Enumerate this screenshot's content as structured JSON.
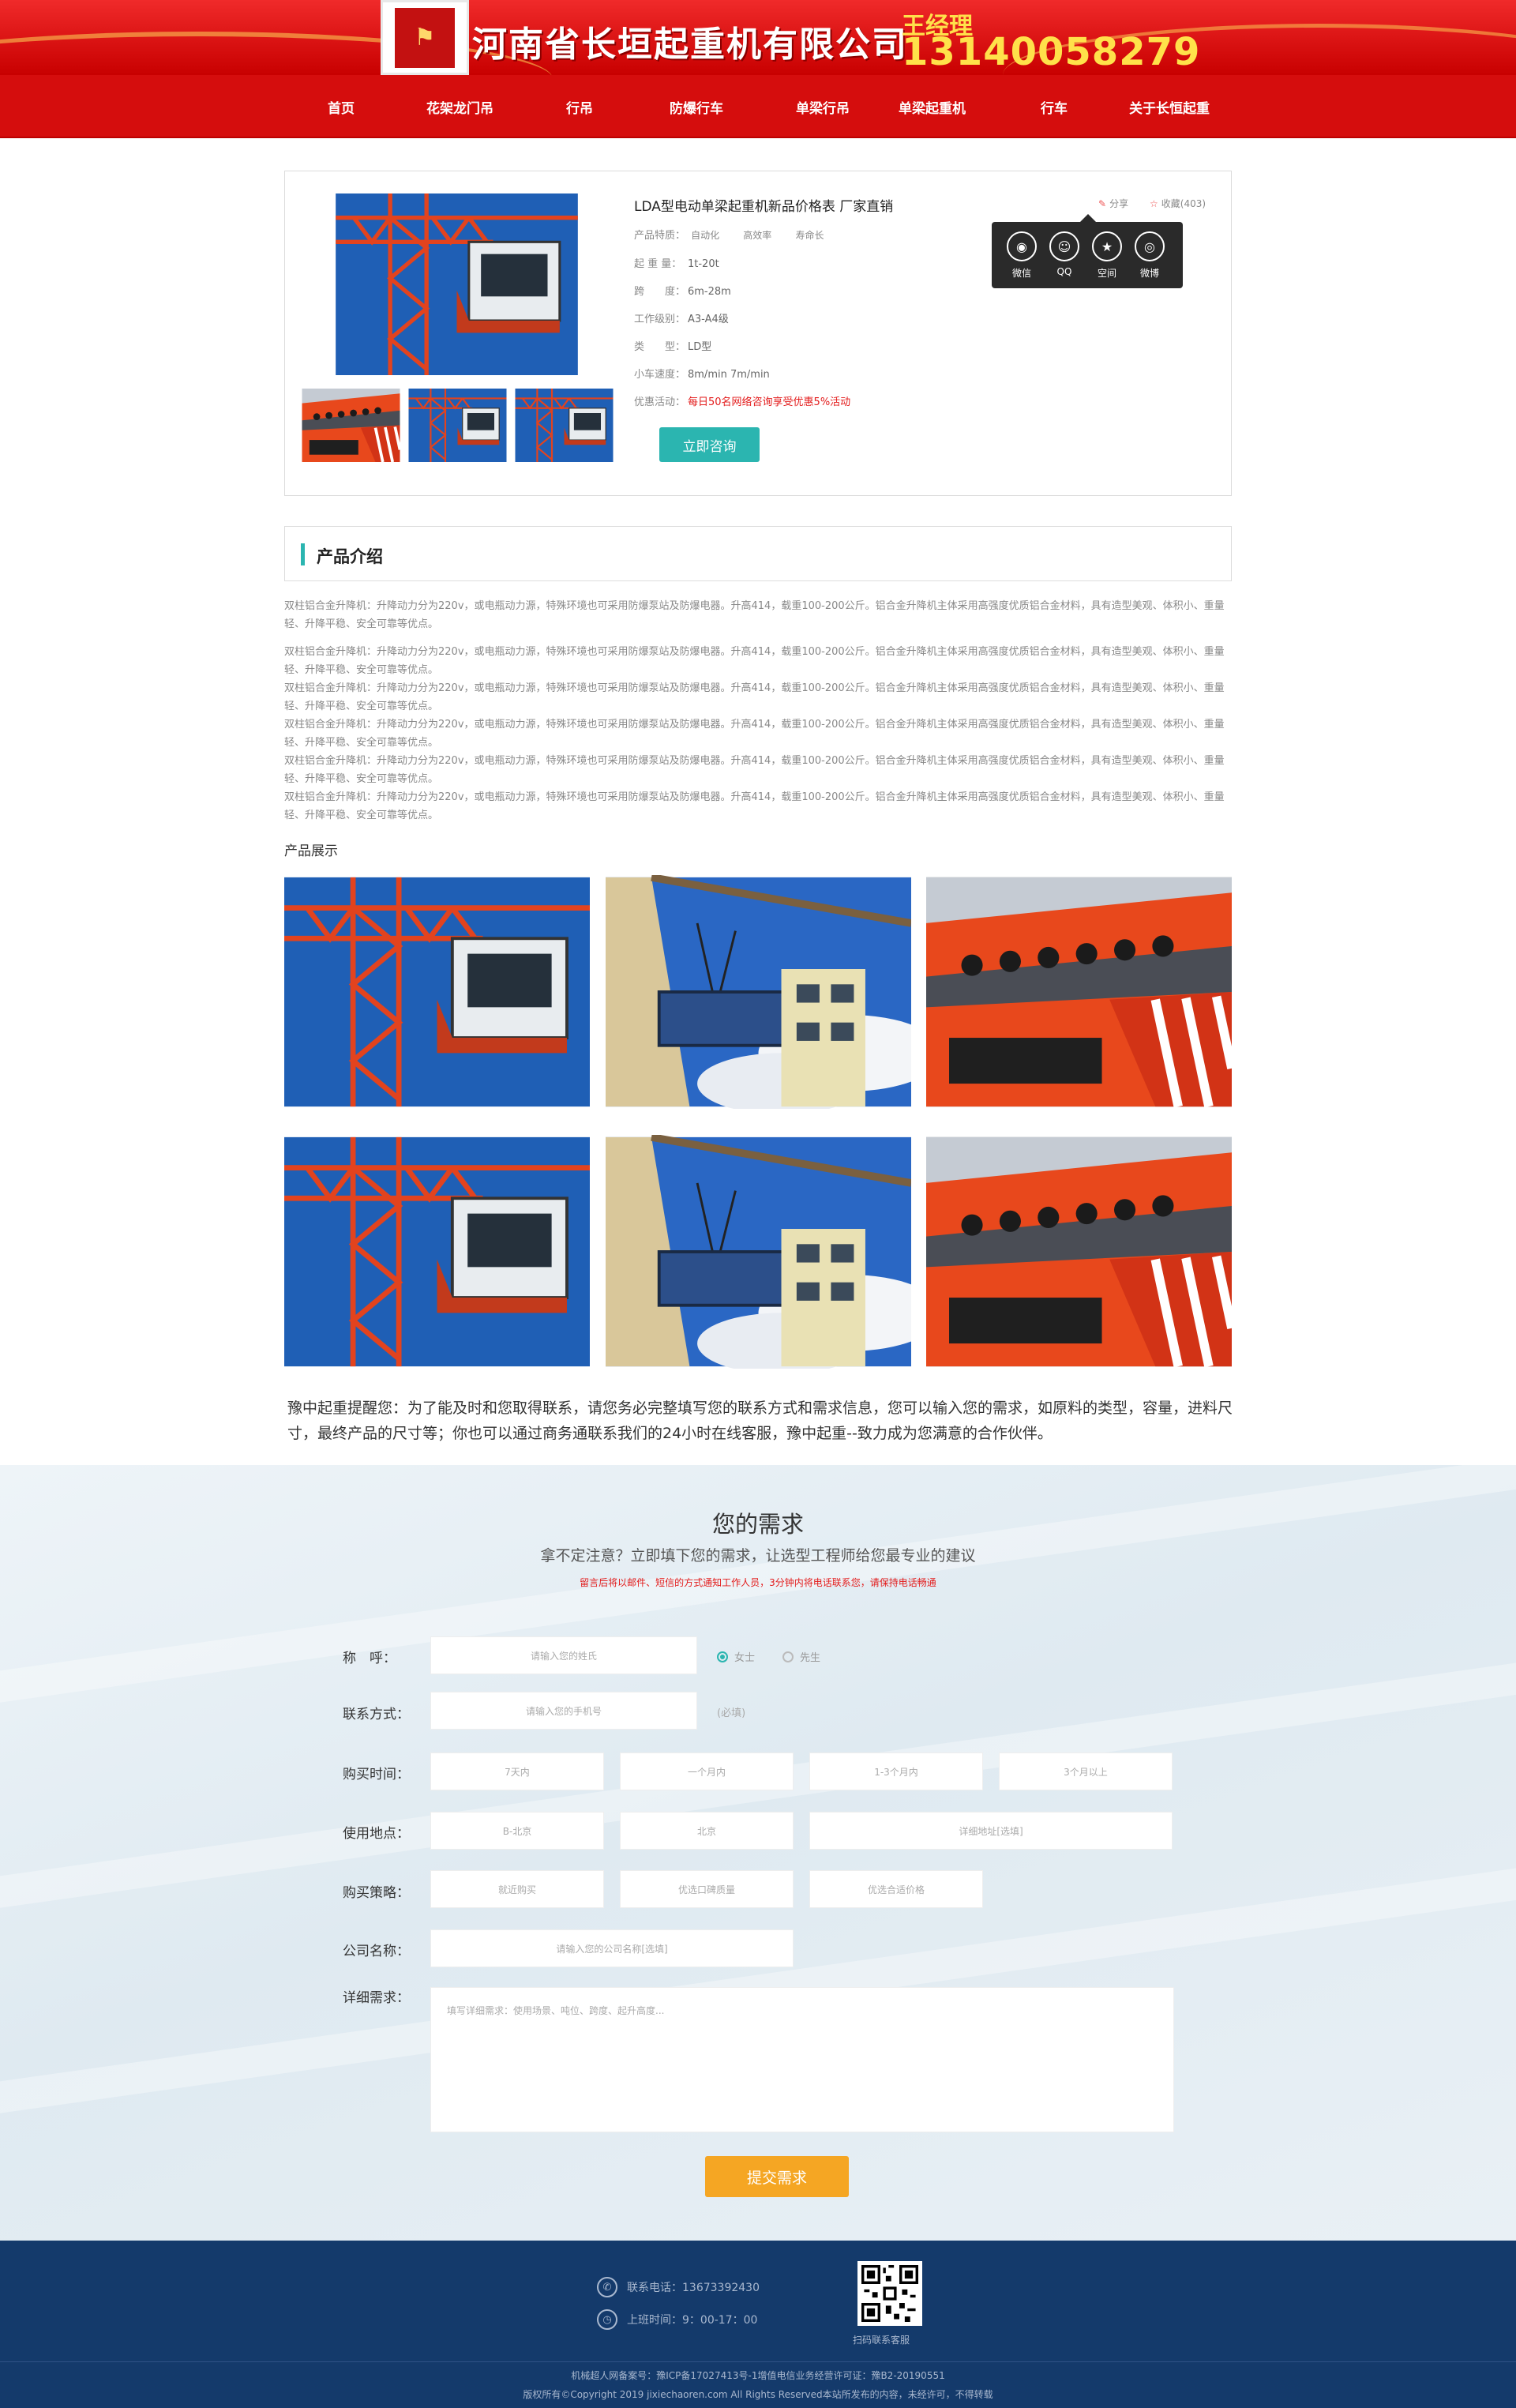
{
  "header": {
    "company_name": "河南省长垣起重机有限公司",
    "manager": "王经理",
    "phone": "13140058279"
  },
  "nav": [
    {
      "label": "首页"
    },
    {
      "label": "花架龙门吊"
    },
    {
      "label": "行吊"
    },
    {
      "label": "防爆行车"
    },
    {
      "label": "单梁行吊"
    },
    {
      "label": "单梁起重机"
    },
    {
      "label": "行车"
    },
    {
      "label": "关于长恒起重"
    }
  ],
  "product": {
    "title": "LDA型电动单梁起重机新品价格表 厂家直销",
    "features_label": "产品特质：",
    "features": [
      "自动化",
      "高效率",
      "寿命长"
    ],
    "specs": [
      {
        "k": "起 重 量：",
        "v": "1t-20t"
      },
      {
        "k": "跨　　度：",
        "v": "6m-28m"
      },
      {
        "k": "工作级别：",
        "v": "A3-A4级"
      },
      {
        "k": "类　　型：",
        "v": "LD型"
      },
      {
        "k": "小车速度：",
        "v": "8m/min 7m/min"
      }
    ],
    "promo_label": "优惠活动：",
    "promo_text": "每日50名网络咨询享受优惠5%活动",
    "consult_button": "立即咨询",
    "share_label": "分享",
    "collect_label": "收藏(403)",
    "share_options": [
      {
        "label": "微信",
        "icon": "wechat-icon"
      },
      {
        "label": "QQ",
        "icon": "qq-icon"
      },
      {
        "label": "空间",
        "icon": "qzone-icon"
      },
      {
        "label": "微博",
        "icon": "weibo-icon"
      }
    ]
  },
  "intro": {
    "heading": "产品介绍",
    "paragraphs": [
      "双柱铝合金升降机：升降动力分为220v，或电瓶动力源，特殊环境也可采用防爆泵站及防爆电器。升高414，载重100-200公斤。铝合金升降机主体采用高强度优质铝合金材料，具有造型美观、体积小、重量轻、升降平稳、安全可靠等优点。",
      "双柱铝合金升降机：升降动力分为220v，或电瓶动力源，特殊环境也可采用防爆泵站及防爆电器。升高414，载重100-200公斤。铝合金升降机主体采用高强度优质铝合金材料，具有造型美观、体积小、重量轻、升降平稳、安全可靠等优点。",
      "双柱铝合金升降机：升降动力分为220v，或电瓶动力源，特殊环境也可采用防爆泵站及防爆电器。升高414，载重100-200公斤。铝合金升降机主体采用高强度优质铝合金材料，具有造型美观、体积小、重量轻、升降平稳、安全可靠等优点。",
      "双柱铝合金升降机：升降动力分为220v，或电瓶动力源，特殊环境也可采用防爆泵站及防爆电器。升高414，载重100-200公斤。铝合金升降机主体采用高强度优质铝合金材料，具有造型美观、体积小、重量轻、升降平稳、安全可靠等优点。",
      "双柱铝合金升降机：升降动力分为220v，或电瓶动力源，特殊环境也可采用防爆泵站及防爆电器。升高414，载重100-200公斤。铝合金升降机主体采用高强度优质铝合金材料，具有造型美观、体积小、重量轻、升降平稳、安全可靠等优点。",
      "双柱铝合金升降机：升降动力分为220v，或电瓶动力源，特殊环境也可采用防爆泵站及防爆电器。升高414，载重100-200公斤。铝合金升降机主体采用高强度优质铝合金材料，具有造型美观、体积小、重量轻、升降平稳、安全可靠等优点。"
    ],
    "show_label": "产品展示"
  },
  "reminder": "豫中起重提醒您：为了能及时和您取得联系，请您务必完整填写您的联系方式和需求信息，您可以输入您的需求，如原料的类型，容量，进料尺寸，最终产品的尺寸等；你也可以通过商务通联系我们的24小时在线客服，豫中起重--致力成为您满意的合作伙伴。",
  "form": {
    "title": "您的需求",
    "subtitle": "拿不定注意？立即填下您的需求，让选型工程师给您最专业的建议",
    "notice": "留言后将以邮件、短信的方式通知工作人员，3分钟内将电话联系您，请保持电话畅通",
    "name_label": "称　呼：",
    "name_placeholder": "请输入您的姓氏",
    "gender_female": "女士",
    "gender_male": "先生",
    "contact_label": "联系方式：",
    "contact_placeholder": "请输入您的手机号",
    "contact_required": "(必填)",
    "time_label": "购买时间：",
    "time_options": [
      "7天内",
      "一个月内",
      "1-3个月内",
      "3个月以上"
    ],
    "location_label": "使用地点：",
    "location_province": "B-北京",
    "location_city": "北京",
    "location_detail": "详细地址[选填]",
    "strategy_label": "购买策略：",
    "strategy_options": [
      "就近购买",
      "优选口碑质量",
      "优选合适价格"
    ],
    "company_label": "公司名称：",
    "company_placeholder": "请输入您的公司名称[选填]",
    "detail_label": "详细需求：",
    "detail_placeholder": "填写详细需求：使用场景、吨位、跨度、起升高度...",
    "submit": "提交需求"
  },
  "footer": {
    "phone_label": "联系电话：13673392430",
    "hours_label": "上班时间：9：00-17：00",
    "qr_caption": "扫码联系客服",
    "icp": "机械超人网备案号：豫ICP备17027413号-1增值电信业务经营许可证：豫B2-20190551",
    "copyright": "版权所有©Copyright 2019 jixiechaoren.com All Rights Reserved本站所发布的内容，未经许可，不得转载"
  }
}
